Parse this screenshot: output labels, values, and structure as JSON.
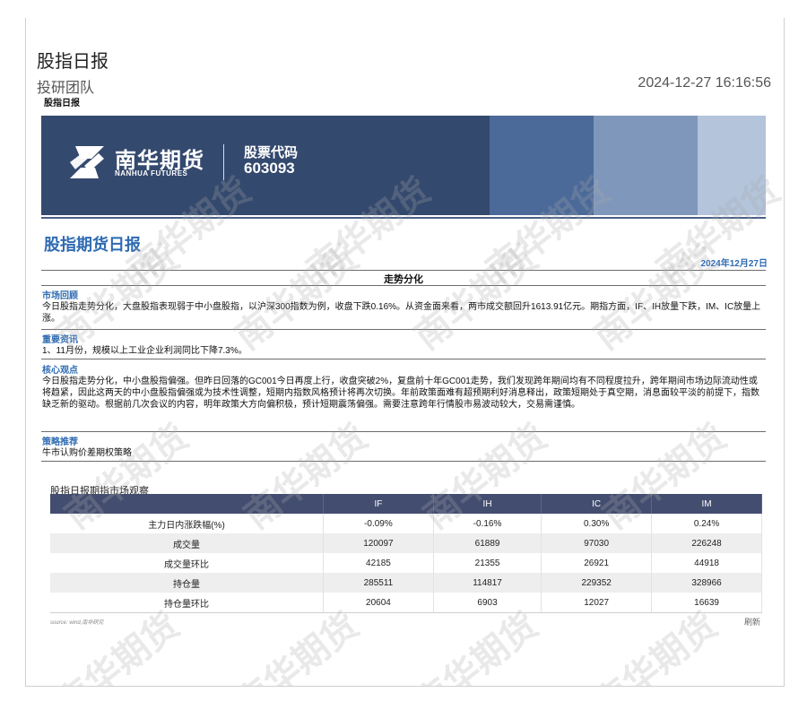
{
  "header": {
    "title": "股指日报",
    "team": "投研团队",
    "subtitle": "股指日报",
    "timestamp": "2024-12-27 16:16:56"
  },
  "banner": {
    "company_cn": "南华期货",
    "company_en": "NANHUA FUTURES",
    "code_label": "股票代码",
    "code": "603093",
    "colors": {
      "main": "#34496e",
      "block1": "#4b6a99",
      "block2": "#7f97ba",
      "block3": "#b3c4db"
    }
  },
  "report": {
    "title": "股指期货日报",
    "date": "2024年12月27日",
    "heading": "走势分化",
    "sections": [
      {
        "title": "市场回顾",
        "body": "今日股指走势分化，大盘股指表现弱于中小盘股指，以沪深300指数为例，收盘下跌0.16%。从资金面来看，两市成交额回升1613.91亿元。期指方面，IF、IH放量下跌，IM、IC放量上涨。"
      },
      {
        "title": "重要资讯",
        "body": "1、11月份，规模以上工业企业利润同比下降7.3%。"
      },
      {
        "title": "核心观点",
        "body": "今日股指走势分化，中小盘股指偏强。但昨日回落的GC001今日再度上行，收盘突破2%，复盘前十年GC001走势，我们发现跨年期间均有不同程度拉升，跨年期间市场边际流动性或将趋紧，因此这两天的中小盘股指偏强或为技术性调整，短期内指数风格预计将再次切换。年前政策面难有超预期利好消息释出，政策短期处于真空期，消息面较平淡的前提下，指数缺乏新的驱动。根据前几次会议的内容，明年政策大方向偏积极，预计短期震荡偏强。需要注意跨年行情股市易波动较大，交易需谨慎。"
      },
      {
        "title": "策略推荐",
        "body": "牛市认购价差期权策略"
      }
    ]
  },
  "table": {
    "title": "股指日报期指市场观察",
    "columns": [
      "",
      "IF",
      "IH",
      "IC",
      "IM"
    ],
    "rows": [
      [
        "主力日内涨跌幅(%)",
        "-0.09%",
        "-0.16%",
        "0.30%",
        "0.24%"
      ],
      [
        "成交量",
        "120097",
        "61889",
        "97030",
        "226248"
      ],
      [
        "成交量环比",
        "42185",
        "21355",
        "26921",
        "44918"
      ],
      [
        "持仓量",
        "285511",
        "114817",
        "229352",
        "328966"
      ],
      [
        "持仓量环比",
        "20604",
        "6903",
        "12027",
        "16639"
      ]
    ],
    "source": "source:  wind,南华研究",
    "refresh_label": "刷新",
    "header_color": "#434d70"
  },
  "watermark": "南华期货",
  "accent_color": "#2e6bb2"
}
